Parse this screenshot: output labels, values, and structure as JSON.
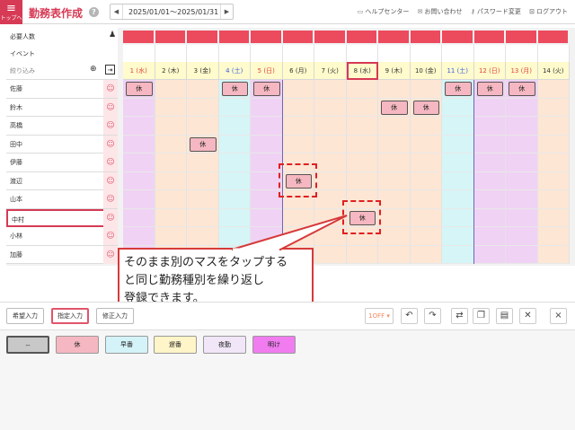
{
  "header": {
    "home_label": "トップへ",
    "title": "勤務表作成",
    "help": "?",
    "period": "2025/01/01～2025/01/31",
    "prev": "◀",
    "next": "▶",
    "links": [
      "ヘルプセンター",
      "お問い合わせ",
      "パスワード変更",
      "ログアウト"
    ]
  },
  "grid": {
    "row_required": "必要人数",
    "row_event": "イベント",
    "filter_placeholder": "絞り込み",
    "days": [
      {
        "label": "1 (水)",
        "type": "hol"
      },
      {
        "label": "2 (木)",
        "type": "wd"
      },
      {
        "label": "3 (金)",
        "type": "wd"
      },
      {
        "label": "4 (土)",
        "type": "sat"
      },
      {
        "label": "5 (日)",
        "type": "sun"
      },
      {
        "label": "6 (月)",
        "type": "wd"
      },
      {
        "label": "7 (火)",
        "type": "wd"
      },
      {
        "label": "8 (水)",
        "type": "cur"
      },
      {
        "label": "9 (木)",
        "type": "wd"
      },
      {
        "label": "10 (金)",
        "type": "wd"
      },
      {
        "label": "11 (土)",
        "type": "sat"
      },
      {
        "label": "12 (日)",
        "type": "sun"
      },
      {
        "label": "13 (月)",
        "type": "hol"
      },
      {
        "label": "14 (火)",
        "type": "wd"
      }
    ],
    "staff": [
      {
        "name": "佐藤",
        "shifts": [
          0,
          3,
          4,
          10,
          11,
          12
        ]
      },
      {
        "name": "鈴木",
        "shifts": [
          8,
          9
        ]
      },
      {
        "name": "高橋",
        "shifts": []
      },
      {
        "name": "田中",
        "shifts": [
          2
        ]
      },
      {
        "name": "伊藤",
        "shifts": []
      },
      {
        "name": "渡辺",
        "shifts": [
          5
        ]
      },
      {
        "name": "山本",
        "shifts": []
      },
      {
        "name": "中村",
        "shifts": [
          7
        ]
      },
      {
        "name": "小林",
        "shifts": []
      },
      {
        "name": "加藤",
        "shifts": []
      }
    ],
    "shift_label": "休",
    "face_icon": "☺"
  },
  "callout": {
    "lines": [
      "そのまま別のマスをタップする",
      "と同じ勤務種別を繰り返し",
      "登録できます。"
    ]
  },
  "toolbar": {
    "buttons": [
      "希望入力",
      "指定入力",
      "修正入力"
    ],
    "lock_label": "1OFF"
  },
  "palette": {
    "items": [
      {
        "label": "--",
        "color": "#c8c8c8"
      },
      {
        "label": "休",
        "color": "#f5b7c1"
      },
      {
        "label": "早番",
        "color": "#d4f3f8"
      },
      {
        "label": "遅番",
        "color": "#fff5c8"
      },
      {
        "label": "夜勤",
        "color": "#f0e6f8"
      },
      {
        "label": "明け",
        "color": "#f07cf0"
      }
    ]
  },
  "colors": {
    "accent": "#d63a55",
    "required_bar": "#ec4a5d"
  }
}
